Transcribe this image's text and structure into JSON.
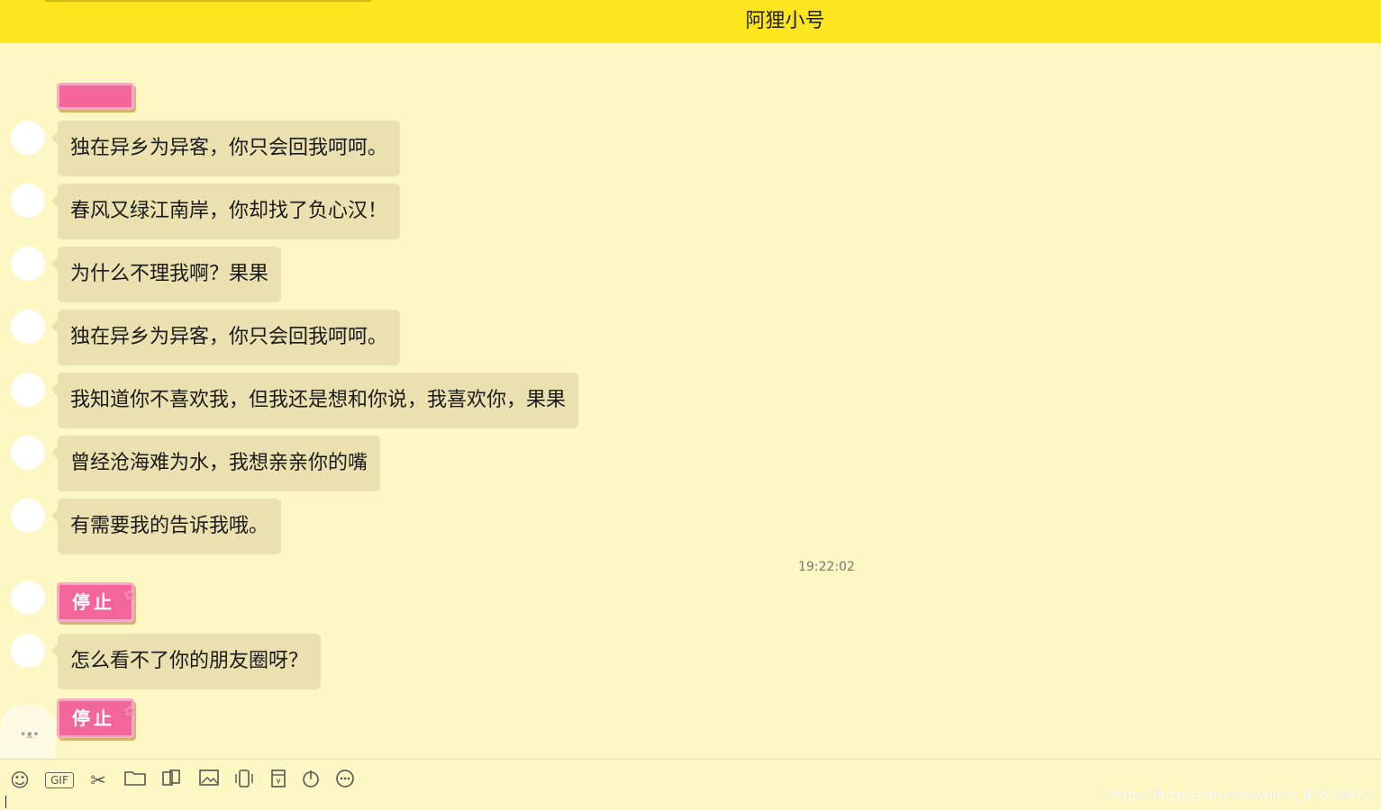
{
  "header": {
    "title": "阿狸小号"
  },
  "messages": [
    {
      "type": "sticker",
      "label": ""
    },
    {
      "type": "text",
      "text": "独在异乡为异客，你只会回我呵呵。"
    },
    {
      "type": "text",
      "text": "春风又绿江南岸，你却找了负心汉！"
    },
    {
      "type": "text",
      "text": "为什么不理我啊？果果"
    },
    {
      "type": "text",
      "text": "独在异乡为异客，你只会回我呵呵。"
    },
    {
      "type": "text",
      "text": "我知道你不喜欢我，但我还是想和你说，我喜欢你，果果"
    },
    {
      "type": "text",
      "text": "曾经沧海难为水，我想亲亲你的嘴"
    },
    {
      "type": "text",
      "text": "有需要我的告诉我哦。"
    },
    {
      "type": "sticker",
      "label": "停止"
    },
    {
      "type": "text",
      "text": "怎么看不了你的朋友圈呀？"
    },
    {
      "type": "sticker",
      "label": "停止"
    }
  ],
  "timestamp": "19:22:02",
  "toolbar": {
    "icons": [
      "emoji-icon",
      "gif-icon",
      "scissors-icon",
      "folder-icon",
      "image-gallery-icon",
      "image-icon",
      "vibrate-icon",
      "red-packet-icon",
      "music-icon",
      "more-icon"
    ],
    "gif_label": "GIF"
  },
  "watermark": "https://blog.csdn.net/weixin_42578412",
  "colors": {
    "titlebar": "#fde51f",
    "background": "#fdf7c3",
    "bubble": "#ebe0af",
    "sticker": "#f2669a"
  }
}
